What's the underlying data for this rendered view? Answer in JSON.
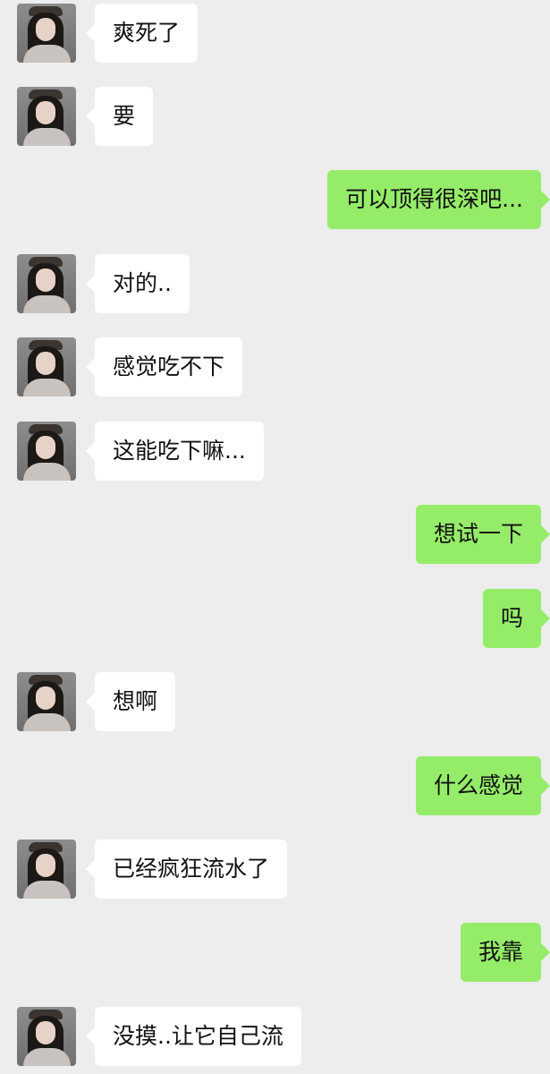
{
  "colors": {
    "background": "#ededed",
    "incoming_bubble": "#ffffff",
    "outgoing_bubble": "#95ec69"
  },
  "messages": [
    {
      "sender": "contact",
      "text": "爽死了"
    },
    {
      "sender": "contact",
      "text": "要"
    },
    {
      "sender": "me",
      "text": "可以顶得很深吧..."
    },
    {
      "sender": "contact",
      "text": "对的.."
    },
    {
      "sender": "contact",
      "text": "感觉吃不下"
    },
    {
      "sender": "contact",
      "text": "这能吃下嘛..."
    },
    {
      "sender": "me",
      "text": "想试一下"
    },
    {
      "sender": "me",
      "text": "吗"
    },
    {
      "sender": "contact",
      "text": "想啊"
    },
    {
      "sender": "me",
      "text": "什么感觉"
    },
    {
      "sender": "contact",
      "text": "已经疯狂流水了"
    },
    {
      "sender": "me",
      "text": "我靠"
    },
    {
      "sender": "contact",
      "text": "没摸..让它自己流"
    }
  ]
}
